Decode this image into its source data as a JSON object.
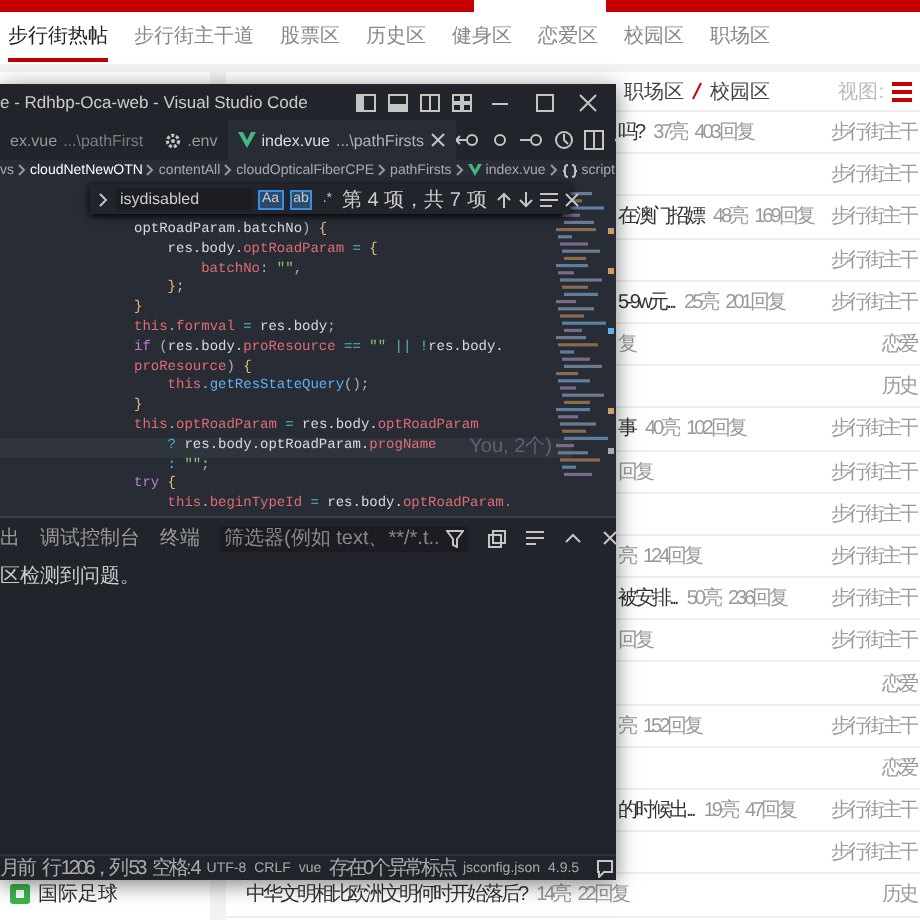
{
  "page": {
    "top_nav": [
      {
        "label": "步行街热帖",
        "selected": true
      },
      {
        "label": "步行街主干道",
        "selected": false
      },
      {
        "label": "股票区",
        "selected": false
      },
      {
        "label": "历史区",
        "selected": false
      },
      {
        "label": "健身区",
        "selected": false
      },
      {
        "label": "恋爱区",
        "selected": false
      },
      {
        "label": "校园区",
        "selected": false
      },
      {
        "label": "职场区",
        "selected": false
      }
    ],
    "sidebar": {
      "items": [
        {
          "label": "国际足球"
        }
      ]
    },
    "main": {
      "breadcrumb": [
        "职场区",
        "校园区"
      ],
      "view_label": "视图:",
      "rows": [
        {
          "title": "吗?",
          "likes": "37亮",
          "replies": "403回复",
          "forum": "步行街主干"
        },
        {
          "forum": "步行街主干"
        },
        {
          "title": "在澳门招嫖",
          "likes": "48亮",
          "replies": "169回复",
          "forum": "步行街主干"
        },
        {
          "forum": "步行街主干"
        },
        {
          "title": "5-9w元...",
          "likes": "25亮",
          "replies": "201回复",
          "forum": "步行街主干"
        },
        {
          "replies": "复",
          "forum": "恋爱"
        },
        {
          "forum": "历史"
        },
        {
          "title": "事",
          "likes": "40亮",
          "replies": "102回复",
          "forum": "步行街主干"
        },
        {
          "replies": "回复",
          "forum": "步行街主干"
        },
        {
          "forum": "步行街主干"
        },
        {
          "likes": "亮",
          "replies": "124回复",
          "forum": "步行街主干"
        },
        {
          "title": "被安排...",
          "likes": "50亮",
          "replies": "236回复",
          "forum": "步行街主干"
        },
        {
          "replies": "回复",
          "forum": "步行街主干"
        },
        {
          "forum": "恋爱"
        },
        {
          "likes": "亮",
          "replies": "152回复",
          "forum": "步行街主干"
        },
        {
          "forum": "恋爱"
        },
        {
          "title": "的时候出...",
          "likes": "19亮",
          "replies": "47回复",
          "forum": "步行街主干"
        },
        {
          "forum": "步行街主干"
        },
        {
          "title": "中华文明相比欧洲文明何时开始落后?",
          "likes": "14亮",
          "replies": "22回复",
          "forum": "历史"
        }
      ]
    }
  },
  "vscode": {
    "title": "e - Rdhbp-Oca-web - Visual Studio Code",
    "tabs": [
      {
        "name": "ex.vue",
        "path": "...\\pathFirst",
        "kind": "vue",
        "selected": false
      },
      {
        "name": ".env",
        "kind": "settings",
        "selected": false
      },
      {
        "name": "index.vue",
        "path": "...\\pathFirsts",
        "kind": "vue",
        "selected": true
      }
    ],
    "breadcrumb": [
      {
        "label": "vs",
        "kind": "folder"
      },
      {
        "label": "cloudNetNewOTN",
        "kind": "folder"
      },
      {
        "label": "contentAll",
        "kind": "folder"
      },
      {
        "label": "cloudOpticalFiberCPE",
        "kind": "folder"
      },
      {
        "label": "pathFirsts",
        "kind": "folder"
      },
      {
        "label": "index.vue",
        "kind": "vue"
      },
      {
        "label": "script",
        "kind": "braces"
      }
    ],
    "find": {
      "value": "isydisabled",
      "result": "第 4 项，共 7 项",
      "options": [
        {
          "label": "Aa",
          "on": true
        },
        {
          "label": "ab",
          "on": true
        },
        {
          "label": ".*",
          "on": false
        }
      ]
    },
    "code": [
      {
        "tokens": [
          {
            "kind": "var",
            "text": "optRoadParam.batchNo"
          },
          {
            "kind": "punc",
            "text": ") "
          },
          {
            "kind": "brace",
            "text": "{"
          }
        ],
        "highlighted": false
      },
      {
        "tokens": [
          {
            "kind": "var",
            "text": "    res.body."
          },
          {
            "kind": "prop",
            "text": "optRoadParam"
          },
          {
            "kind": "op",
            "text": " = "
          },
          {
            "kind": "brace",
            "text": "{"
          }
        ],
        "highlighted": false
      },
      {
        "tokens": [
          {
            "kind": "prop",
            "text": "        batchNo"
          },
          {
            "kind": "punc",
            "text": ": "
          },
          {
            "kind": "str",
            "text": "\"\""
          },
          {
            "kind": "punc",
            "text": ","
          }
        ],
        "highlighted": false
      },
      {
        "tokens": [
          {
            "kind": "brace",
            "text": "    };"
          }
        ],
        "highlighted": false
      },
      {
        "tokens": [
          {
            "kind": "brace",
            "text": "}"
          }
        ],
        "highlighted": false
      },
      {
        "tokens": [
          {
            "kind": "this",
            "text": "this"
          },
          {
            "kind": "punc",
            "text": "."
          },
          {
            "kind": "prop",
            "text": "formval"
          },
          {
            "kind": "op",
            "text": " = "
          },
          {
            "kind": "var",
            "text": "res.body"
          },
          {
            "kind": "punc",
            "text": ";"
          }
        ],
        "highlighted": false
      },
      {
        "tokens": [
          {
            "kind": "kw",
            "text": "if"
          },
          {
            "kind": "punc",
            "text": " ("
          },
          {
            "kind": "var",
            "text": "res.body."
          },
          {
            "kind": "prop",
            "text": "proResource"
          },
          {
            "kind": "op",
            "text": " == "
          },
          {
            "kind": "str",
            "text": "\"\""
          },
          {
            "kind": "op",
            "text": " || !"
          },
          {
            "kind": "var",
            "text": "res.body."
          }
        ],
        "highlighted": false
      },
      {
        "tokens": [
          {
            "kind": "prop",
            "text": "proResource"
          },
          {
            "kind": "punc",
            "text": ") "
          },
          {
            "kind": "brace",
            "text": "{"
          }
        ],
        "highlighted": false
      },
      {
        "tokens": [
          {
            "kind": "this",
            "text": "    this"
          },
          {
            "kind": "punc",
            "text": "."
          },
          {
            "kind": "fn",
            "text": "getResStateQuery"
          },
          {
            "kind": "punc",
            "text": "();"
          }
        ],
        "highlighted": false
      },
      {
        "tokens": [
          {
            "kind": "brace",
            "text": "}"
          }
        ],
        "highlighted": false
      },
      {
        "tokens": [
          {
            "kind": "this",
            "text": "this"
          },
          {
            "kind": "punc",
            "text": "."
          },
          {
            "kind": "prop",
            "text": "optRoadParam"
          },
          {
            "kind": "op",
            "text": " = "
          },
          {
            "kind": "var",
            "text": "res.body."
          },
          {
            "kind": "prop",
            "text": "optRoadParam"
          }
        ],
        "highlighted": false
      },
      {
        "tokens": [
          {
            "kind": "op",
            "text": "    ? "
          },
          {
            "kind": "var",
            "text": "res.body.optRoadParam."
          },
          {
            "kind": "prop",
            "text": "progName"
          }
        ],
        "blame": "You, 2个)",
        "highlighted": true
      },
      {
        "tokens": [
          {
            "kind": "op",
            "text": "    : "
          },
          {
            "kind": "str",
            "text": "\"\""
          },
          {
            "kind": "punc",
            "text": ";"
          }
        ],
        "highlighted": false
      },
      {
        "tokens": [
          {
            "kind": "kw",
            "text": "try"
          },
          {
            "kind": "brace",
            "text": " {"
          }
        ],
        "highlighted": false
      },
      {
        "tokens": [
          {
            "kind": "this",
            "text": "    this"
          },
          {
            "kind": "punc",
            "text": "."
          },
          {
            "kind": "prop",
            "text": "beginTypeId"
          },
          {
            "kind": "op",
            "text": " = "
          },
          {
            "kind": "var",
            "text": "res.body."
          },
          {
            "kind": "prop",
            "text": "optRoadParam."
          }
        ],
        "highlighted": false
      }
    ],
    "panel": {
      "tabs": [
        {
          "label": "出"
        },
        {
          "label": "调试控制台"
        },
        {
          "label": "终端"
        }
      ],
      "filter_placeholder": "筛选器(例如 text、**/*.t...",
      "message": "区检测到问题。"
    },
    "status_bar": [
      "月前",
      "行 1206，列 53",
      "空格: 4",
      "UTF-8",
      "CRLF",
      "vue",
      "存在0个异常标点",
      "jsconfig.json",
      "4.9.5"
    ]
  }
}
